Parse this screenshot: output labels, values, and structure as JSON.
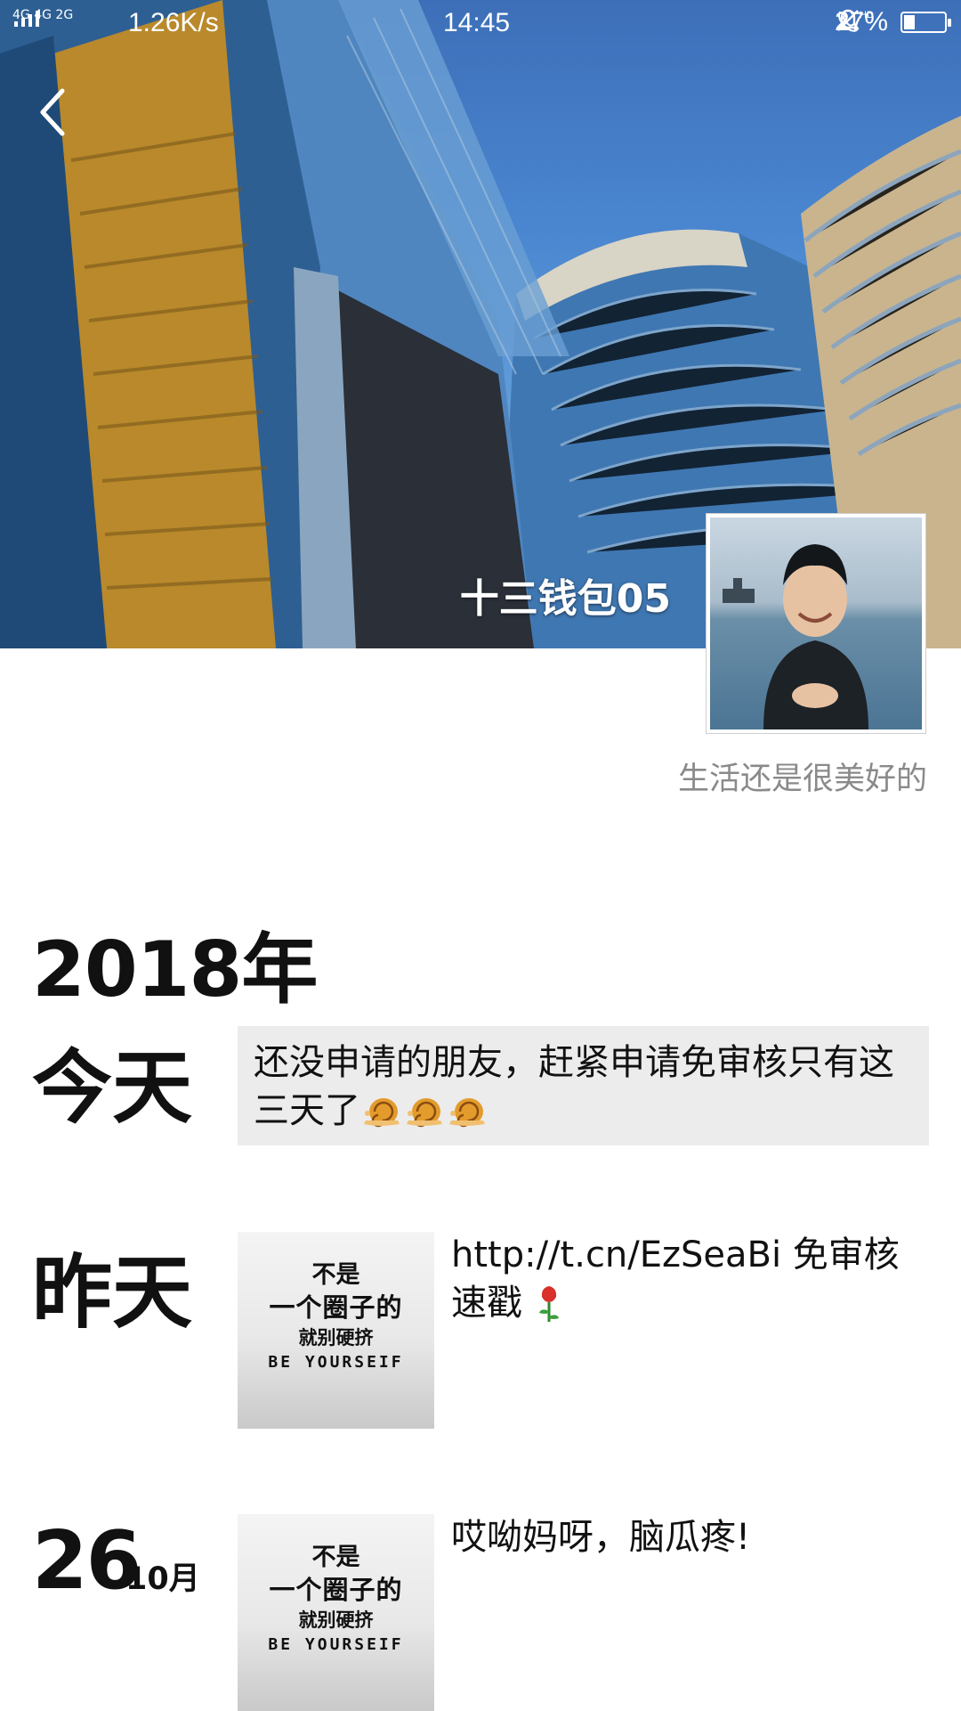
{
  "status_bar": {
    "network_1": "4G 4G",
    "network_2": "2G",
    "speed": "1.26K/s",
    "time": "14:45",
    "hd": "HD",
    "battery_text": "27%",
    "battery_level": 0.27
  },
  "profile": {
    "nickname": "十三钱包05",
    "signature": "生活还是很美好的"
  },
  "timeline": {
    "year": "2018年",
    "posts": [
      {
        "date_label": "今天",
        "text": "还没申请的朋友，赶紧申请免审核只有这三天了",
        "emoji_count": 3
      },
      {
        "date_label": "昨天",
        "caption": "http://t.cn/EzSeaBi 免审核速戳",
        "emoji": "🌹",
        "image_text": [
          "不是",
          "一个圈子的",
          "就别硬挤",
          "BE YOURSEIF"
        ]
      },
      {
        "day": "26",
        "month": "10月",
        "caption": "哎呦妈呀，脑瓜疼!",
        "image_text": [
          "不是",
          "一个圈子的",
          "就别硬挤",
          "BE YOURSEIF"
        ]
      }
    ]
  },
  "colors": {
    "accent_text": "#111111",
    "signature": "#8a8a8a",
    "post_bg": "#ececec"
  }
}
